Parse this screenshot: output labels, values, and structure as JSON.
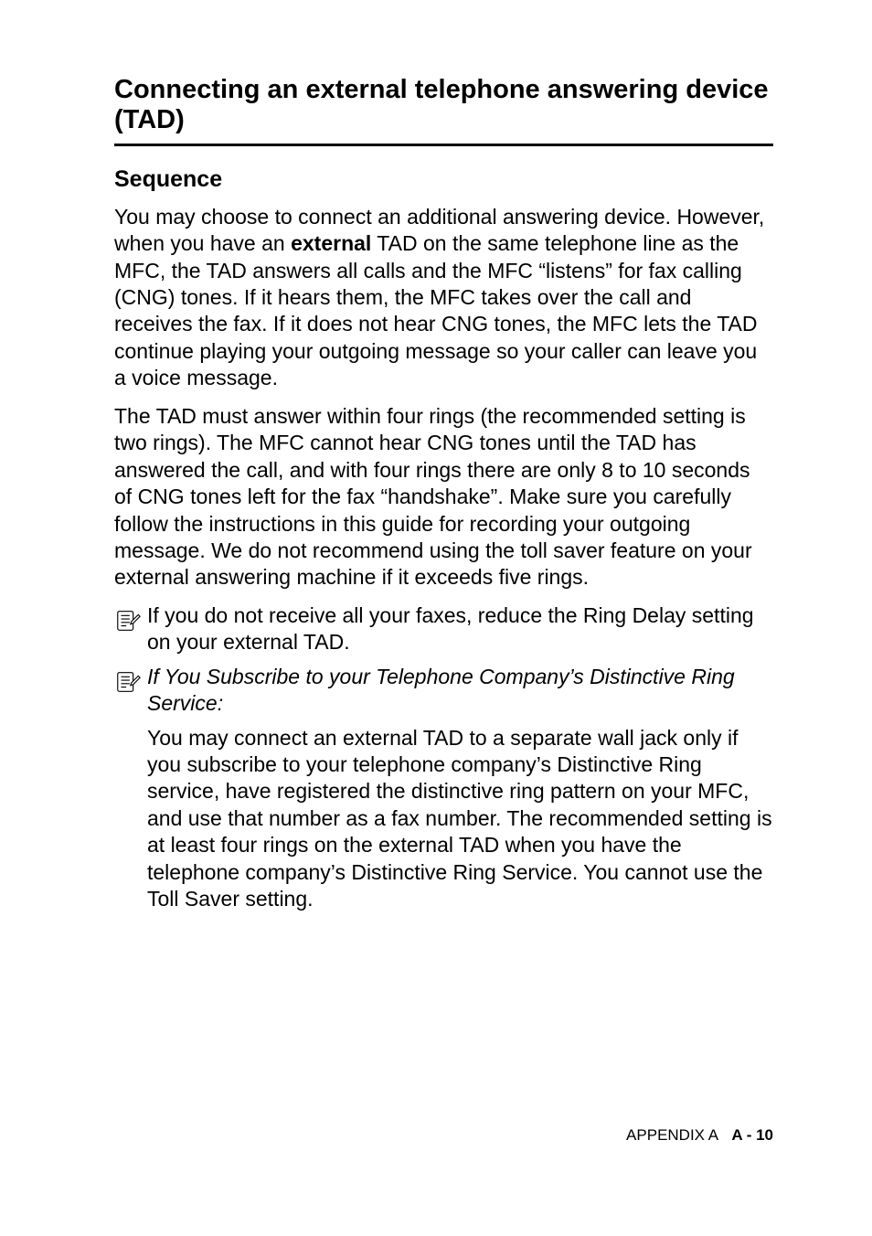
{
  "heading": "Connecting an external telephone answering device (TAD)",
  "subheading": "Sequence",
  "para1_pre": "You may choose to connect an additional answering device. However, when you have an ",
  "para1_bold": "external",
  "para1_post": " TAD on the same telephone line as the MFC, the TAD answers all calls and the MFC “listens” for fax calling (CNG) tones. If it hears them, the MFC takes over the call and receives the fax. If it does not hear CNG tones, the MFC lets the TAD continue playing your outgoing message so your caller can leave you a voice message.",
  "para2": "The TAD must answer within four rings (the recommended setting is two rings). The MFC cannot hear CNG tones until the TAD has answered the call, and with four rings there are only 8 to 10 seconds of CNG tones left for the fax “handshake”. Make sure you carefully follow the instructions in this guide for recording your outgoing message. We do not recommend using the toll saver feature on your external answering machine if it exceeds five rings.",
  "note1": "If you do not receive all your faxes, reduce the Ring Delay setting on your external TAD.",
  "note2_title": "If You Subscribe to your Telephone Company’s Distinctive Ring Service:",
  "note2_body": "You may connect an external TAD to a separate wall jack only if you subscribe to your telephone company’s Distinctive Ring service, have registered the distinctive ring pattern on your MFC, and use that number as a fax number. The recommended setting is at least four rings on the external TAD when you have the telephone company’s Distinctive Ring Service. You cannot use the Toll Saver setting.",
  "footer_label": "APPENDIX A",
  "footer_page": "A - 10"
}
